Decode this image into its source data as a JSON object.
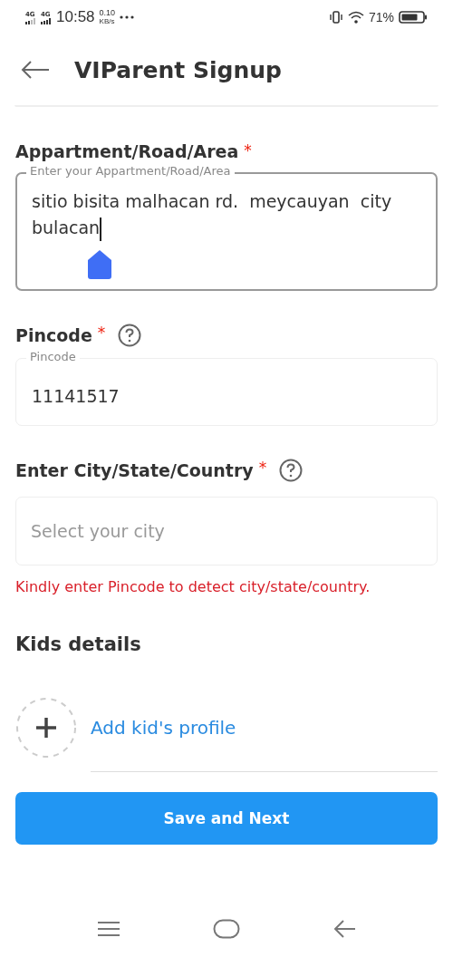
{
  "status_bar": {
    "network_1": "4G",
    "network_2": "4G",
    "time": "10:58",
    "speed": "0.10",
    "speed_unit": "KB/s",
    "battery": "71%"
  },
  "header": {
    "title": "VIParent Signup"
  },
  "address": {
    "label": "Appartment/Road/Area",
    "required": "*",
    "floating_label": "Enter your Appartment/Road/Area",
    "value_lines": [
      "sitio bisita malhacan rd.  meycauyan  city",
      "bulacan"
    ]
  },
  "pincode": {
    "label": "Pincode",
    "required": "*",
    "floating_label": "Pincode",
    "value": "11141517"
  },
  "city": {
    "label": "Enter City/State/Country",
    "required": "*",
    "placeholder": "Select your city",
    "error": "Kindly enter Pincode to detect city/state/country."
  },
  "kids": {
    "title": "Kids details",
    "add_label": "Add kid's profile"
  },
  "button": {
    "label": "Save and Next"
  }
}
